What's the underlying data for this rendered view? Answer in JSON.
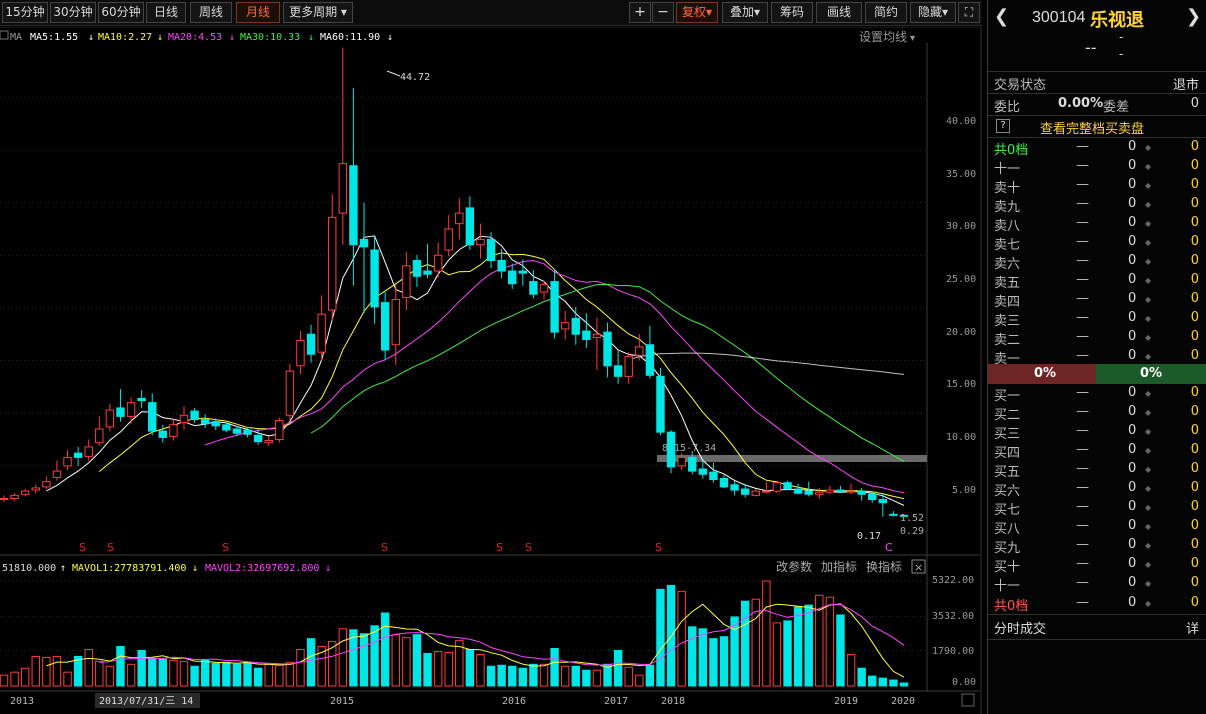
{
  "toolbar": {
    "periods": [
      "15分钟",
      "30分钟",
      "60分钟",
      "日线",
      "周线",
      "月线",
      "更多周期"
    ],
    "active_period": "月线",
    "plus": "+",
    "minus": "−",
    "tools": [
      "复权",
      "叠加",
      "筹码",
      "画线",
      "简约",
      "隐藏"
    ]
  },
  "ma_bar": {
    "prefix": "MA",
    "items": [
      {
        "label": "MA5:1.55",
        "color": "#ffffff"
      },
      {
        "label": "MA10:2.27",
        "color": "#ffff3c"
      },
      {
        "label": "MA20:4.53",
        "color": "#ff44ff"
      },
      {
        "label": "MA30:10.33",
        "color": "#44ee44"
      },
      {
        "label": "MA60:11.90",
        "color": "#ffffff"
      }
    ],
    "settings": "设置均线"
  },
  "vol_bar": {
    "value": "51810.000",
    "items": [
      {
        "label": "MAVOL1:27783791.400",
        "color": "#ffff3c"
      },
      {
        "label": "MAVOL2:32697692.800",
        "color": "#ff44ff"
      }
    ],
    "links": [
      "改参数",
      "加指标",
      "换指标"
    ]
  },
  "price_axis": [
    "40.00",
    "35.00",
    "30.00",
    "25.00",
    "20.00",
    "15.00",
    "10.00",
    "5.00"
  ],
  "vol_axis": [
    "5322.00",
    "3532.00",
    "1790.00",
    "0.00"
  ],
  "time_axis": [
    "2013",
    "2015",
    "2016",
    "2017",
    "2018",
    "2019",
    "2020"
  ],
  "cursor_date": "2013/07/31/三 14",
  "annotations": {
    "high": "44.72",
    "low": "0.17",
    "gap_label": "8.15-7.34",
    "price_last": "1.52",
    "price_ref": "0.29",
    "dividend_mark": "S",
    "c_mark": "C"
  },
  "chart_data": [
    {
      "type": "candlestick",
      "title": "乐视退 月线",
      "ylim": [
        0,
        46
      ],
      "x": [
        "2012-08",
        "2012-09",
        "2012-10",
        "2012-11",
        "2012-12",
        "2013-01",
        "2013-02",
        "2013-03",
        "2013-04",
        "2013-05",
        "2013-06",
        "2013-07",
        "2013-08",
        "2013-09",
        "2013-10",
        "2013-11",
        "2013-12",
        "2014-01",
        "2014-02",
        "2014-03",
        "2014-04",
        "2014-05",
        "2014-06",
        "2014-07",
        "2014-08",
        "2014-09",
        "2014-10",
        "2014-11",
        "2014-12",
        "2015-01",
        "2015-02",
        "2015-03",
        "2015-04",
        "2015-05",
        "2015-06",
        "2015-07",
        "2015-08",
        "2015-09",
        "2015-10",
        "2015-11",
        "2015-12",
        "2016-01",
        "2016-02",
        "2016-03",
        "2016-04",
        "2016-05",
        "2016-06",
        "2016-07",
        "2016-08",
        "2016-09",
        "2016-10",
        "2016-11",
        "2016-12",
        "2017-01",
        "2017-02",
        "2017-03",
        "2017-04",
        "2017-05",
        "2017-06",
        "2017-07",
        "2017-08",
        "2017-09",
        "2017-10",
        "2017-11",
        "2017-12",
        "2018-01",
        "2018-02",
        "2018-03",
        "2018-04",
        "2018-05",
        "2018-06",
        "2018-07",
        "2018-08",
        "2018-09",
        "2018-10",
        "2018-11",
        "2018-12",
        "2019-01",
        "2019-02",
        "2019-03",
        "2019-04",
        "2019-05",
        "2019-06",
        "2019-07",
        "2019-08",
        "2019-09"
      ],
      "open": [
        1.8,
        1.9,
        2.3,
        2.7,
        3.0,
        3.9,
        5.0,
        6.2,
        5.9,
        7.2,
        8.7,
        10.5,
        9.7,
        11.4,
        11.0,
        8.3,
        7.8,
        9.1,
        10.2,
        9.4,
        9.2,
        8.9,
        8.5,
        8.4,
        7.9,
        7.2,
        7.5,
        9.8,
        14.5,
        17.5,
        15.8,
        19.8,
        29.0,
        33.5,
        26.5,
        25.5,
        20.5,
        16.5,
        21.0,
        24.5,
        23.5,
        23.5,
        25.5,
        28.0,
        29.5,
        26.0,
        26.5,
        24.5,
        23.5,
        23.5,
        22.5,
        21.5,
        22.5,
        18.0,
        19.0,
        17.8,
        17.2,
        17.7,
        14.5,
        13.5,
        15.5,
        16.5,
        13.5,
        8.2,
        5.0,
        5.8,
        4.7,
        4.4,
        3.8,
        3.2,
        2.8,
        2.2,
        2.6,
        2.6,
        3.4,
        2.8,
        2.6,
        2.3,
        2.5,
        2.7,
        2.6,
        2.6,
        2.3,
        1.8,
        0.4,
        0.3
      ],
      "close": [
        1.9,
        2.2,
        2.6,
        2.9,
        3.5,
        4.5,
        5.8,
        5.8,
        6.8,
        8.5,
        10.3,
        9.7,
        11.0,
        11.2,
        8.3,
        7.7,
        8.9,
        9.8,
        9.4,
        9.0,
        8.8,
        8.4,
        8.1,
        8.0,
        7.3,
        7.4,
        9.3,
        14.0,
        16.9,
        15.6,
        19.4,
        28.6,
        33.7,
        26.0,
        25.8,
        20.1,
        16.0,
        20.8,
        24.0,
        23.0,
        23.2,
        25.0,
        27.5,
        29.0,
        26.0,
        26.5,
        24.5,
        23.5,
        22.3,
        23.3,
        21.3,
        22.2,
        17.7,
        18.6,
        17.5,
        17.0,
        17.5,
        14.5,
        13.5,
        15.4,
        16.3,
        13.6,
        8.2,
        4.9,
        5.8,
        4.5,
        4.2,
        3.7,
        3.0,
        2.7,
        2.3,
        2.6,
        2.6,
        3.4,
        2.8,
        2.4,
        2.3,
        2.5,
        2.7,
        2.6,
        2.6,
        2.3,
        1.8,
        1.5,
        0.3,
        0.29
      ],
      "high": [
        2.2,
        2.4,
        2.8,
        3.2,
        4.0,
        5.5,
        6.5,
        6.8,
        7.5,
        9.7,
        10.9,
        12.3,
        11.5,
        12.2,
        11.9,
        8.9,
        9.5,
        10.7,
        10.5,
        9.9,
        9.5,
        9.1,
        8.8,
        8.7,
        8.5,
        7.8,
        9.6,
        14.7,
        17.8,
        18.4,
        21.2,
        30.8,
        44.72,
        40.9,
        30.0,
        26.8,
        21.5,
        22.2,
        25.3,
        25.0,
        26.1,
        26.2,
        28.8,
        30.4,
        30.6,
        28.0,
        27.2,
        25.6,
        24.2,
        24.6,
        23.6,
        22.6,
        23.7,
        19.7,
        20.1,
        19.5,
        19.1,
        18.6,
        16.0,
        15.8,
        17.5,
        18.3,
        14.3,
        8.4,
        6.2,
        6.4,
        5.5,
        5.3,
        4.3,
        3.6,
        3.3,
        2.8,
        3.5,
        3.6,
        3.6,
        3.3,
        3.5,
        2.9,
        3.1,
        3.1,
        3.3,
        2.9,
        2.6,
        2.4,
        0.7,
        0.4
      ],
      "low": [
        1.6,
        1.7,
        2.1,
        2.4,
        2.8,
        3.6,
        4.6,
        5.0,
        5.5,
        6.9,
        8.3,
        9.2,
        9.0,
        10.5,
        7.9,
        7.2,
        7.4,
        8.4,
        9.1,
        8.6,
        8.4,
        8.2,
        7.8,
        7.7,
        7.0,
        6.9,
        7.2,
        9.3,
        13.7,
        14.8,
        15.0,
        18.8,
        26.0,
        22.1,
        19.5,
        18.5,
        15.0,
        14.6,
        19.8,
        22.0,
        22.8,
        22.9,
        24.9,
        26.5,
        25.5,
        24.7,
        23.8,
        22.8,
        21.8,
        22.1,
        20.9,
        20.8,
        17.1,
        17.0,
        16.5,
        16.2,
        14.1,
        13.4,
        12.8,
        12.8,
        15.0,
        13.3,
        7.9,
        4.3,
        4.6,
        4.2,
        3.8,
        3.4,
        2.9,
        2.2,
        2.0,
        2.1,
        2.4,
        2.4,
        2.7,
        2.3,
        2.1,
        1.9,
        2.3,
        2.4,
        2.3,
        1.7,
        1.5,
        0.17,
        0.2,
        0.25
      ]
    },
    {
      "type": "bar",
      "title": "VOL",
      "ylim": [
        0,
        5322
      ],
      "values": [
        550,
        700,
        900,
        1500,
        1450,
        1500,
        700,
        1500,
        1850,
        1250,
        1000,
        2000,
        1100,
        1800,
        1400,
        1350,
        1300,
        1250,
        1000,
        1300,
        1150,
        1200,
        1100,
        1200,
        900,
        1100,
        1050,
        1200,
        1850,
        2400,
        2000,
        2250,
        2900,
        2850,
        2650,
        3050,
        3700,
        2600,
        2450,
        2600,
        1650,
        1750,
        1700,
        2300,
        1850,
        1600,
        1000,
        1050,
        1000,
        900,
        1100,
        1100,
        1900,
        1000,
        1000,
        800,
        800,
        1100,
        1800,
        950,
        550,
        1050,
        4900,
        5100,
        4800,
        3000,
        2900,
        2400,
        2500,
        3500,
        4300,
        4400,
        5322,
        3200,
        3300,
        4000,
        4100,
        4600,
        4500,
        3600,
        1600,
        900,
        500,
        400,
        300,
        150
      ]
    }
  ],
  "quote": {
    "code": "300104",
    "name": "乐视退",
    "price": "--",
    "change": "-",
    "change_pct": "-",
    "trade_status_label": "交易状态",
    "trade_status": "退市",
    "weibi_label": "委比",
    "weibi": "0.00%",
    "weicha_label": "委差",
    "weicha": "0",
    "help_icon": "?",
    "full_book": "查看完整档买卖盘",
    "total_top": "共0档",
    "sell_levels": [
      "十一",
      "卖十",
      "卖九",
      "卖八",
      "卖七",
      "卖六",
      "卖五",
      "卖四",
      "卖三",
      "卖二",
      "卖一"
    ],
    "buy_levels": [
      "买一",
      "买二",
      "买三",
      "买四",
      "买五",
      "买六",
      "买七",
      "买八",
      "买九",
      "买十",
      "十一"
    ],
    "total_bottom": "共0档",
    "dash": "—",
    "zero": "0",
    "sell_pct": "0%",
    "buy_pct": "0%",
    "ticks_label": "分时成交",
    "detail": "详"
  }
}
